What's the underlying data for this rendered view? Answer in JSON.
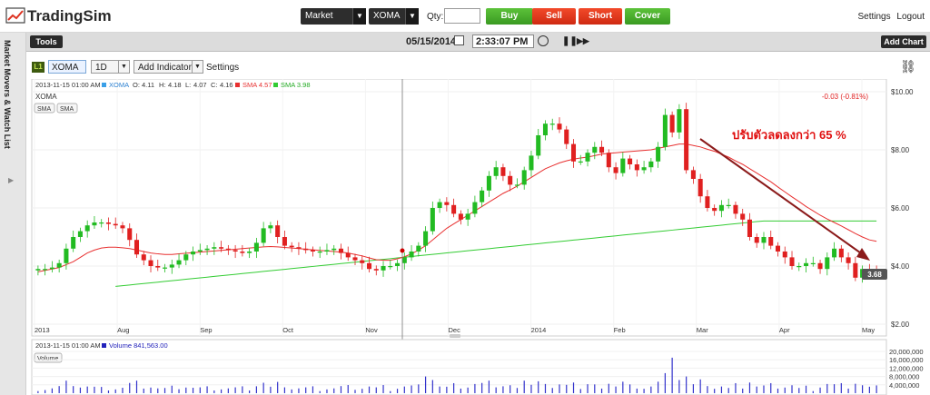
{
  "app": {
    "name": "TradingSim"
  },
  "topbar": {
    "order_type": "Market",
    "symbol": "XOMA",
    "qty_label": "Qty:",
    "qty_value": "",
    "buttons": {
      "buy": "Buy",
      "sell": "Sell",
      "short": "Short",
      "cover": "Cover"
    },
    "settings": "Settings",
    "logout": "Logout"
  },
  "sidebar": {
    "label": "Market Movers & Watch List"
  },
  "toolbar": {
    "tools": "Tools",
    "date": "05/15/2014",
    "time": "2:33:07 PM",
    "add_chart": "Add Chart"
  },
  "chart_controls": {
    "layer": "L1",
    "symbol": "XOMA",
    "interval": "1D",
    "add_indicator": "Add Indicator",
    "settings": "Settings"
  },
  "chart_header": {
    "timestamp": "2013-11-15 01:00 AM",
    "symbol": "XOMA",
    "open_label": "O:",
    "open": "4.11",
    "high_label": "H:",
    "high": "4.18",
    "low_label": "L:",
    "low": "4.07",
    "close_label": "C:",
    "close": "4.16",
    "sma1": "SMA 4.57",
    "sma2": "SMA 3.98",
    "title": "XOMA",
    "sma_tag1": "SMA",
    "sma_tag2": "SMA",
    "change": "-0.03 (-0.81%)",
    "last_price": "3.68",
    "annotation": "ปรับตัวลดลงกว่า 65 %"
  },
  "volume_header": {
    "timestamp": "2013-11-15 01:00 AM",
    "label": "Volume 841,563.00",
    "tag": "Volume"
  },
  "colors": {
    "up": "#22bb22",
    "down": "#e02020",
    "sma_red": "#e83030",
    "sma_green": "#33cc33",
    "annotation": "#e01010",
    "arrow": "#8b1a1a"
  },
  "chart_data": {
    "type": "candlestick",
    "ylim": [
      2,
      10
    ],
    "yticks": [
      "$2.00",
      "$4.00",
      "$6.00",
      "$8.00",
      "$10.00"
    ],
    "xticks": [
      "2013",
      "Aug",
      "Sep",
      "Oct",
      "Nov",
      "Dec",
      "2014",
      "Feb",
      "Mar",
      "Apr",
      "May"
    ],
    "close": [
      3.9,
      3.9,
      3.95,
      4.1,
      4.6,
      5.0,
      5.2,
      5.4,
      5.5,
      5.5,
      5.45,
      5.4,
      5.3,
      4.9,
      4.4,
      4.2,
      4.0,
      3.95,
      3.95,
      4.05,
      4.2,
      4.4,
      4.5,
      4.55,
      4.6,
      4.65,
      4.6,
      4.55,
      4.5,
      4.45,
      4.5,
      4.8,
      5.3,
      5.4,
      5.0,
      4.7,
      4.65,
      4.6,
      4.55,
      4.5,
      4.5,
      4.55,
      4.6,
      4.45,
      4.3,
      4.2,
      4.1,
      3.9,
      3.85,
      4.0,
      4.0,
      4.1,
      4.3,
      4.5,
      4.7,
      5.2,
      6.0,
      6.2,
      6.1,
      5.8,
      5.6,
      5.8,
      6.2,
      6.6,
      7.1,
      7.4,
      7.1,
      6.8,
      6.8,
      7.3,
      7.8,
      8.5,
      8.9,
      8.9,
      8.7,
      8.2,
      7.6,
      7.6,
      7.9,
      8.1,
      7.9,
      7.4,
      7.2,
      7.7,
      7.5,
      7.3,
      7.4,
      7.6,
      8.1,
      9.2,
      8.6,
      9.4,
      7.3,
      7.0,
      6.4,
      6.0,
      5.9,
      6.1,
      6.1,
      5.8,
      5.6,
      5.0,
      4.8,
      5.0,
      4.7,
      4.5,
      4.3,
      4.0,
      4.0,
      4.1,
      4.1,
      3.9,
      4.3,
      4.6,
      4.3,
      4.1,
      3.6,
      3.9,
      3.8,
      3.68
    ],
    "sma_fast": [
      3.8,
      3.85,
      3.9,
      3.95,
      4.05,
      4.15,
      4.3,
      4.45,
      4.55,
      4.62,
      4.65,
      4.65,
      4.63,
      4.6,
      4.55,
      4.5,
      4.45,
      4.42,
      4.4,
      4.4,
      4.42,
      4.44,
      4.46,
      4.48,
      4.5,
      4.52,
      4.54,
      4.56,
      4.58,
      4.6,
      4.62,
      4.64,
      4.66,
      4.67,
      4.66,
      4.64,
      4.62,
      4.6,
      4.58,
      4.56,
      4.54,
      4.52,
      4.5,
      4.48,
      4.45,
      4.4,
      4.35,
      4.28,
      4.22,
      4.2,
      4.2,
      4.25,
      4.32,
      4.42,
      4.55,
      4.7,
      4.9,
      5.1,
      5.3,
      5.45,
      5.6,
      5.75,
      5.9,
      6.05,
      6.2,
      6.35,
      6.5,
      6.62,
      6.75,
      6.9,
      7.05,
      7.2,
      7.35,
      7.45,
      7.55,
      7.62,
      7.68,
      7.72,
      7.75,
      7.8,
      7.85,
      7.88,
      7.9,
      7.92,
      7.94,
      7.96,
      7.98,
      8.0,
      8.05,
      8.1,
      8.15,
      8.2,
      8.2,
      8.15,
      8.1,
      8.02,
      7.95,
      7.85,
      7.75,
      7.62,
      7.5,
      7.35,
      7.2,
      7.05,
      6.9,
      6.72,
      6.55,
      6.38,
      6.22,
      6.05,
      5.9,
      5.75,
      5.62,
      5.5,
      5.38,
      5.25,
      5.12,
      5.0,
      4.9,
      4.85
    ],
    "sma_slow_start": 3.3,
    "sma_slow_end": 5.55,
    "volume_axis": [
      "4,000,000",
      "8,000,000",
      "12,000,000",
      "16,000,000",
      "20,000,000"
    ]
  }
}
